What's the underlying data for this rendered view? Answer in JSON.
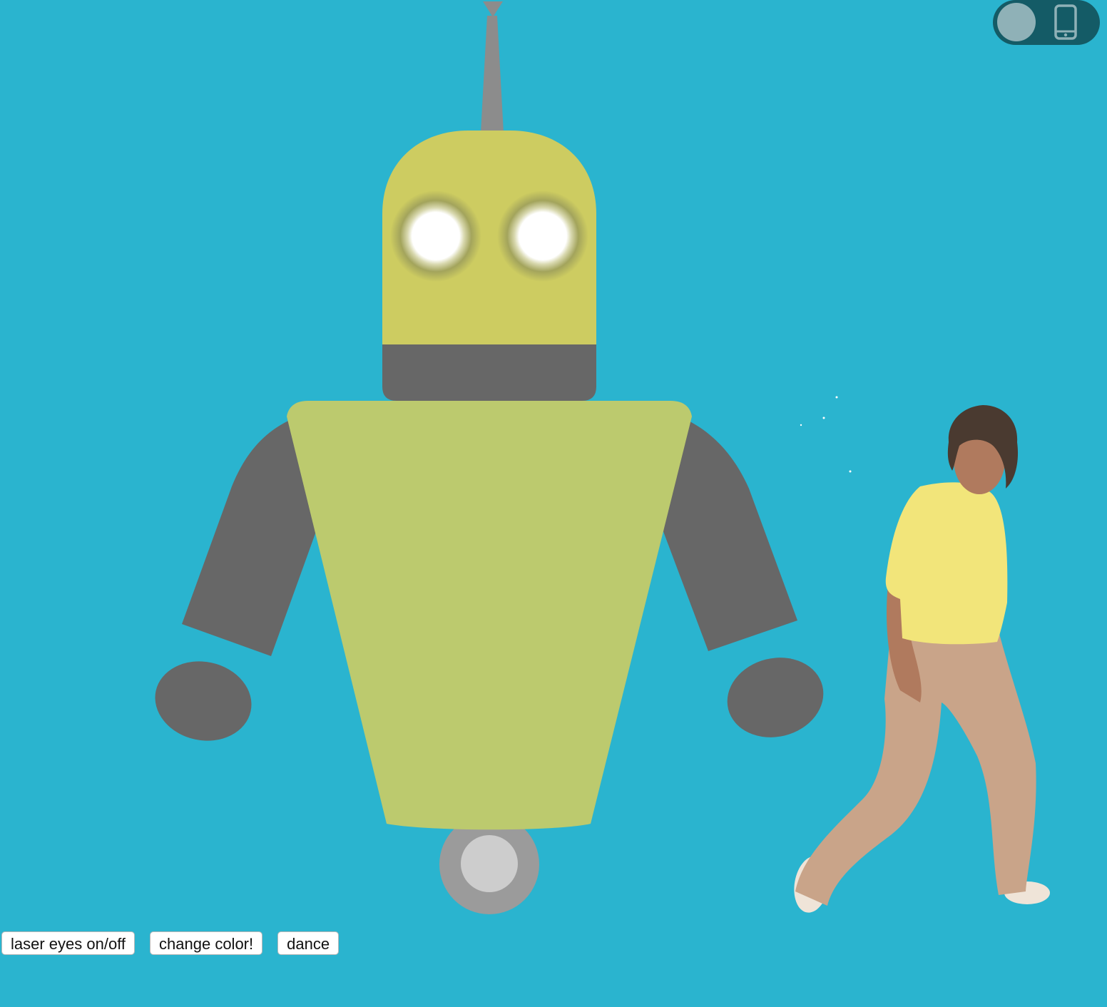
{
  "page": {
    "background_color": "#2AB4CF"
  },
  "robot": {
    "head_color": "#CDCC61",
    "body_color": "#BCCA6E",
    "limb_color": "#676767",
    "antenna_color": "#8C8C8C",
    "wheel_outer_color": "#9B9B9B",
    "wheel_inner_color": "#CDCDCD",
    "laser_eyes_on": true,
    "eye_glow_color": "#FFFFFF"
  },
  "dancer": {
    "icon": "dancing-man-icon",
    "shirt_color": "#F2E57A",
    "pants_color": "#C9A489",
    "skin_color": "#B07A5E",
    "hair_color": "#4A3A30"
  },
  "device_toggle": {
    "icon": "phone-icon",
    "track_color": "#145B66",
    "knob_color": "#8FB1B7",
    "icon_color": "#8FB1B7",
    "enabled": false
  },
  "controls": {
    "laser_label": "laser eyes on/off",
    "color_label": "change color!",
    "dance_label": "dance"
  }
}
